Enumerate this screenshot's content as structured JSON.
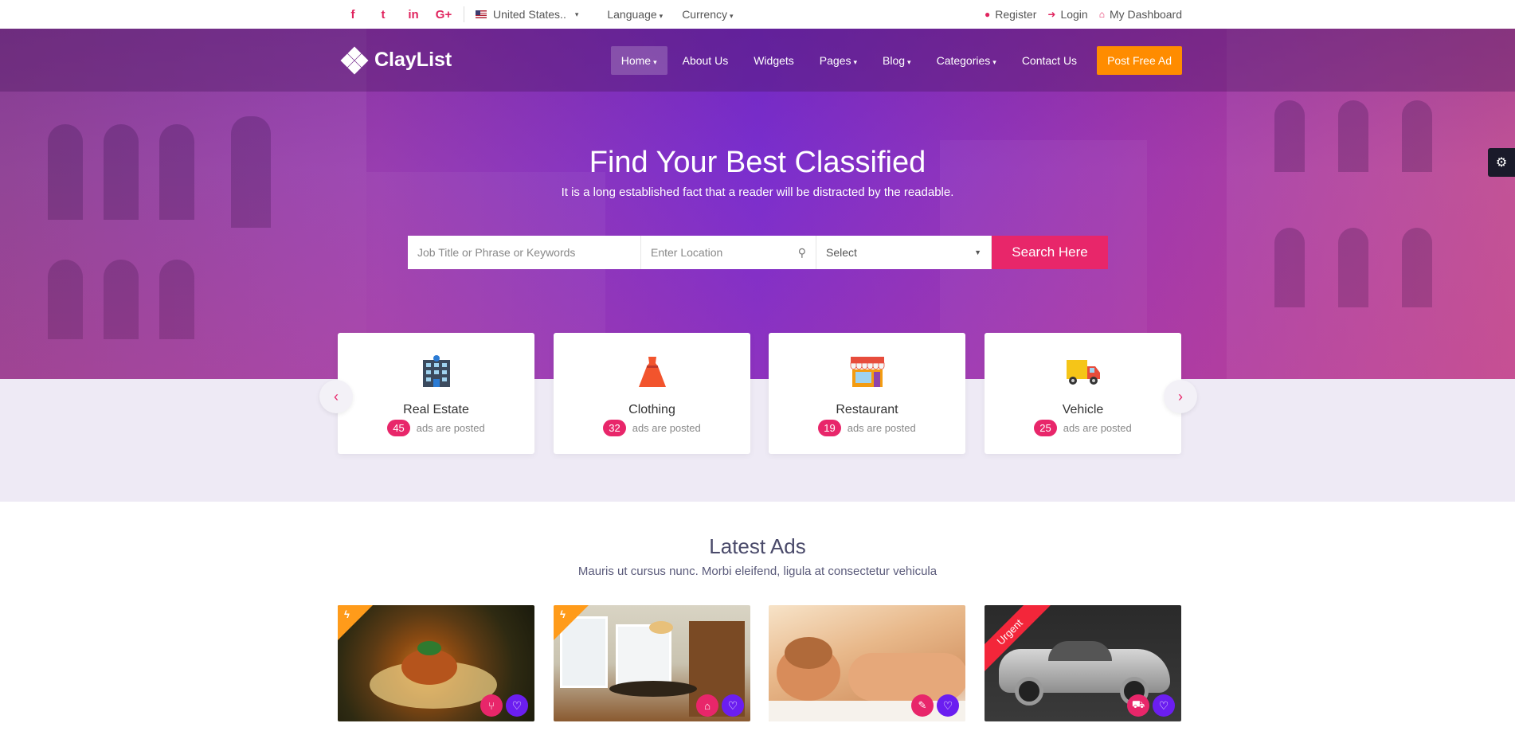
{
  "topbar": {
    "social": [
      {
        "icon": "facebook-icon",
        "glyph": "f"
      },
      {
        "icon": "twitter-icon",
        "glyph": "t"
      },
      {
        "icon": "linkedin-icon",
        "glyph": "in"
      },
      {
        "icon": "google-plus-icon",
        "glyph": "G+"
      }
    ],
    "country": "United States..",
    "language": "Language",
    "currency": "Currency",
    "register": "Register",
    "login": "Login",
    "dashboard": "My Dashboard"
  },
  "nav": {
    "brand": "ClayList",
    "items": [
      "Home",
      "About Us",
      "Widgets",
      "Pages",
      "Blog",
      "Categories",
      "Contact Us"
    ],
    "post_ad": "Post Free Ad"
  },
  "hero": {
    "title": "Find Your Best Classified",
    "subtitle": "It is a long established fact that a reader will be distracted by the readable."
  },
  "search": {
    "keyword_placeholder": "Job Title or Phrase or Keywords",
    "location_placeholder": "Enter Location",
    "select_value": "Select",
    "button": "Search Here"
  },
  "categories": [
    {
      "name": "Real Estate",
      "count": "45",
      "suffix": "ads are posted",
      "icon": "building-icon"
    },
    {
      "name": "Clothing",
      "count": "32",
      "suffix": "ads are posted",
      "icon": "dress-icon"
    },
    {
      "name": "Restaurant",
      "count": "19",
      "suffix": "ads are posted",
      "icon": "shop-icon"
    },
    {
      "name": "Vehicle",
      "count": "25",
      "suffix": "ads are posted",
      "icon": "truck-icon"
    }
  ],
  "latest": {
    "title": "Latest Ads",
    "subtitle": "Mauris ut cursus nunc. Morbi eleifend, ligula at consectetur vehicula",
    "ads": [
      {
        "image": "food-photo",
        "ribbon": "flash",
        "category_icon": "cutlery-icon"
      },
      {
        "image": "dining-room-photo",
        "ribbon": "flash",
        "category_icon": "home-icon"
      },
      {
        "image": "spa-massage-photo",
        "ribbon": "",
        "category_icon": "brush-icon"
      },
      {
        "image": "sports-car-photo",
        "ribbon": "Urgent",
        "category_icon": "car-icon"
      }
    ]
  },
  "colors": {
    "accent": "#e8266a",
    "post_ad": "#ff8c00",
    "favorite": "#6b1ef0",
    "band": "#eeeaf5"
  }
}
